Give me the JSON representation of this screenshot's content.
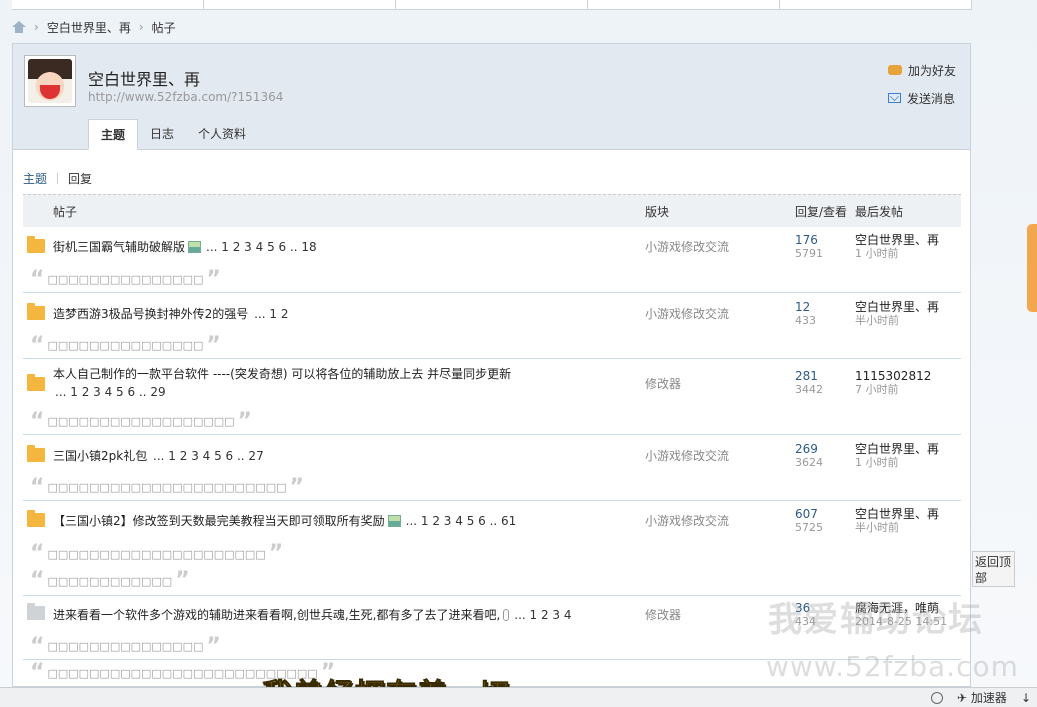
{
  "breadcrumb": {
    "user": "空白世界里、再",
    "section": "帖子"
  },
  "profile": {
    "name": "空白世界里、再",
    "url": "http://www.52fzba.com/?151364",
    "add_friend": "加为好友",
    "send_message": "发送消息",
    "tabs": [
      "主题",
      "日志",
      "个人资料"
    ]
  },
  "subtabs": [
    "主题",
    "回复"
  ],
  "table": {
    "headers": {
      "title": "帖子",
      "forum": "版块",
      "rv": "回复/查看",
      "last": "最后发帖"
    },
    "rows": [
      {
        "title": "街机三国霸气辅助破解版",
        "pages": "... 1 2 3 4 5 6 .. 18",
        "forum": "小游戏修改交流",
        "replies": "176",
        "views": "5791",
        "last_user": "空白世界里、再",
        "last_time": "1 小时前",
        "quote": "□□□□□□□□□□□□□□□"
      },
      {
        "title": "造梦西游3极品号换封神外传2的强号",
        "pages": "... 1 2",
        "forum": "小游戏修改交流",
        "replies": "12",
        "views": "433",
        "last_user": "空白世界里、再",
        "last_time": "半小时前",
        "quote": "□□□□□□□□□□□□□□□"
      },
      {
        "title": "本人自己制作的一款平台软件 ----(突发奇想) 可以将各位的辅助放上去 并尽量同步更新",
        "pages": "... 1 2 3 4 5 6 .. 29",
        "forum": "修改器",
        "replies": "281",
        "views": "3442",
        "last_user": "1115302812",
        "last_time": "7 小时前",
        "quote": "□□□□□□□□□□□□□□□□□□"
      },
      {
        "title": "三国小镇2pk礼包",
        "pages": "... 1 2 3 4 5 6 .. 27",
        "forum": "小游戏修改交流",
        "replies": "269",
        "views": "3624",
        "last_user": "空白世界里、再",
        "last_time": "1 小时前",
        "quote": "□□□□□□□□□□□□□□□□□□□□□□□"
      },
      {
        "title": "【三国小镇2】修改签到天数最完美教程当天即可领取所有奖励",
        "pages": "... 1 2 3 4 5 6 .. 61",
        "forum": "小游戏修改交流",
        "replies": "607",
        "views": "5725",
        "last_user": "空白世界里、再",
        "last_time": "半小时前",
        "quote": "□□□□□□□□□□□□□□□□□□□□□",
        "quote2": "□□□□□□□□□□□□"
      },
      {
        "title": "进来看看一个软件多个游戏的辅助进来看看啊,创世兵魂,生死,都有多了去了进来看吧,",
        "pages": "... 1 2 3 4",
        "forum": "修改器",
        "replies": "36",
        "views": "434",
        "last_user": "腐海无涯，唯萌",
        "last_time": "2014-8-25 14:51",
        "quote": "□□□□□□□□□□□□□□□",
        "quote2": "□□□□□□□□□□□□□□□□□□□□□□□□□□"
      }
    ]
  },
  "back_top": "返回顶部",
  "watermark": {
    "cn": "我爱辅助论坛",
    "url": "www.52fzba.com"
  },
  "subtitle": "我曾经拥有着一切",
  "statusbar": {
    "accelerator": "加速器"
  }
}
